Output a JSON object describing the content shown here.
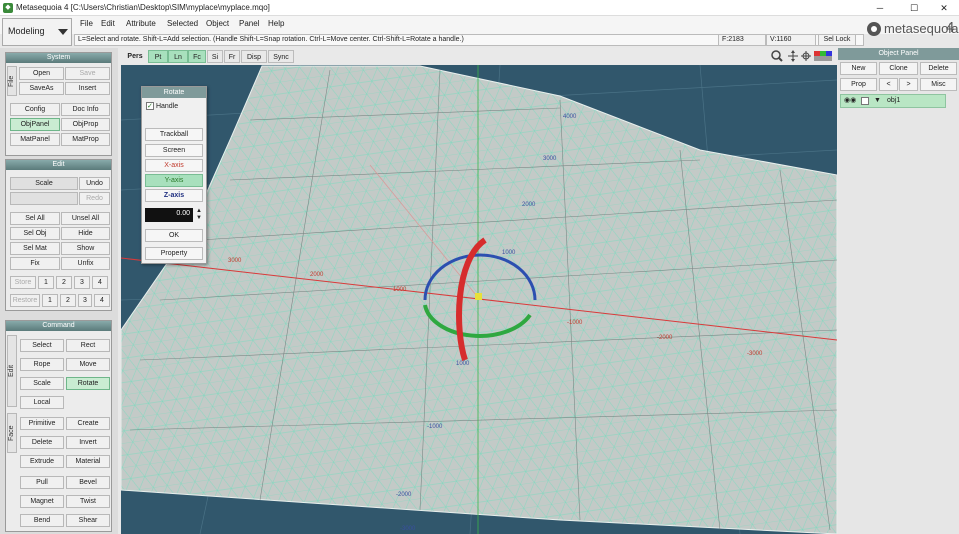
{
  "window": {
    "title": "Metasequoia 4 [C:\\Users\\Christian\\Desktop\\SIM\\myplace\\myplace.mqo]",
    "minimize": "─",
    "maximize": "☐",
    "close": "✕"
  },
  "mode": "Modeling",
  "menu": [
    "File",
    "Edit",
    "Attribute",
    "Selected",
    "Object",
    "Panel",
    "Help"
  ],
  "logo": {
    "text": "metasequoia",
    "version": "4"
  },
  "hint": "L=Select and rotate. Shift-L=Add selection. (Handle Shift-L=Snap rotation. Ctrl-L=Move center. Ctrl-Shift-L=Rotate a handle.)",
  "status": {
    "faces": "F:2183",
    "vertices": "V:1160",
    "sel_lock": "Sel Lock"
  },
  "system_panel": {
    "title": "System",
    "side": "File",
    "open": "Open",
    "save": "Save",
    "saveas": "SaveAs",
    "insert": "Insert",
    "config": "Config",
    "docinfo": "Doc Info",
    "objpanel": "ObjPanel",
    "objprop": "ObjProp",
    "matpanel": "MatPanel",
    "matprop": "MatProp"
  },
  "edit_panel": {
    "title": "Edit",
    "scale": "Scale",
    "undo": "Undo",
    "redo": "Redo",
    "selall": "Sel All",
    "unselall": "Unsel All",
    "selobj": "Sel Obj",
    "hide": "Hide",
    "selmat": "Sel Mat",
    "show": "Show",
    "fix": "Fix",
    "unfix": "Unfix",
    "store": "Store",
    "restore": "Restore",
    "n1": "1",
    "n2": "2",
    "n3": "3",
    "n4": "4"
  },
  "command_panel": {
    "title": "Command",
    "side_edit": "Edit",
    "side_face": "Face",
    "select": "Select",
    "rect": "Rect",
    "rope": "Rope",
    "move": "Move",
    "scale": "Scale",
    "rotate": "Rotate",
    "local": "Local",
    "primitive": "Primitive",
    "create": "Create",
    "delete": "Delete",
    "invert": "Invert",
    "extrude": "Extrude",
    "material": "Material",
    "pull": "Pull",
    "bevel": "Bevel",
    "magnet": "Magnet",
    "twist": "Twist",
    "bend": "Bend",
    "shear": "Shear"
  },
  "view_toolbar": [
    "Pers",
    "Pt",
    "Ln",
    "Fc",
    "Si",
    "Fr",
    "Disp",
    "Sync"
  ],
  "view_tool_icons": [
    "magnifier-icon",
    "pan-icon",
    "rotate-view-icon",
    "color-icon"
  ],
  "rotate_panel": {
    "title": "Rotate",
    "handle": "Handle",
    "trackball": "Trackball",
    "screen": "Screen",
    "xaxis": "X-axis",
    "yaxis": "Y-axis",
    "zaxis": "Z-axis",
    "value": "0.00",
    "ok": "OK",
    "property": "Property"
  },
  "object_panel": {
    "title": "Object Panel",
    "new": "New",
    "clone": "Clone",
    "delete": "Delete",
    "prop": "Prop",
    "prev": "<",
    "next": ">",
    "misc": "Misc",
    "object_name": "obj1"
  },
  "axis_ticks": {
    "x": [
      "3000",
      "2000",
      "1000",
      "-1000",
      "-2000",
      "-3000"
    ],
    "z": [
      "4000",
      "3000",
      "2000",
      "1000",
      "1000",
      "-1000",
      "-2000",
      "-3000"
    ]
  },
  "colors": {
    "x_axis": "#d93a3a",
    "y_axis": "#39b54a",
    "z_axis": "#3a55d9",
    "active": "#a8e0bd",
    "viewport_bg": "#31576c",
    "mesh": "#c8cfcc"
  }
}
